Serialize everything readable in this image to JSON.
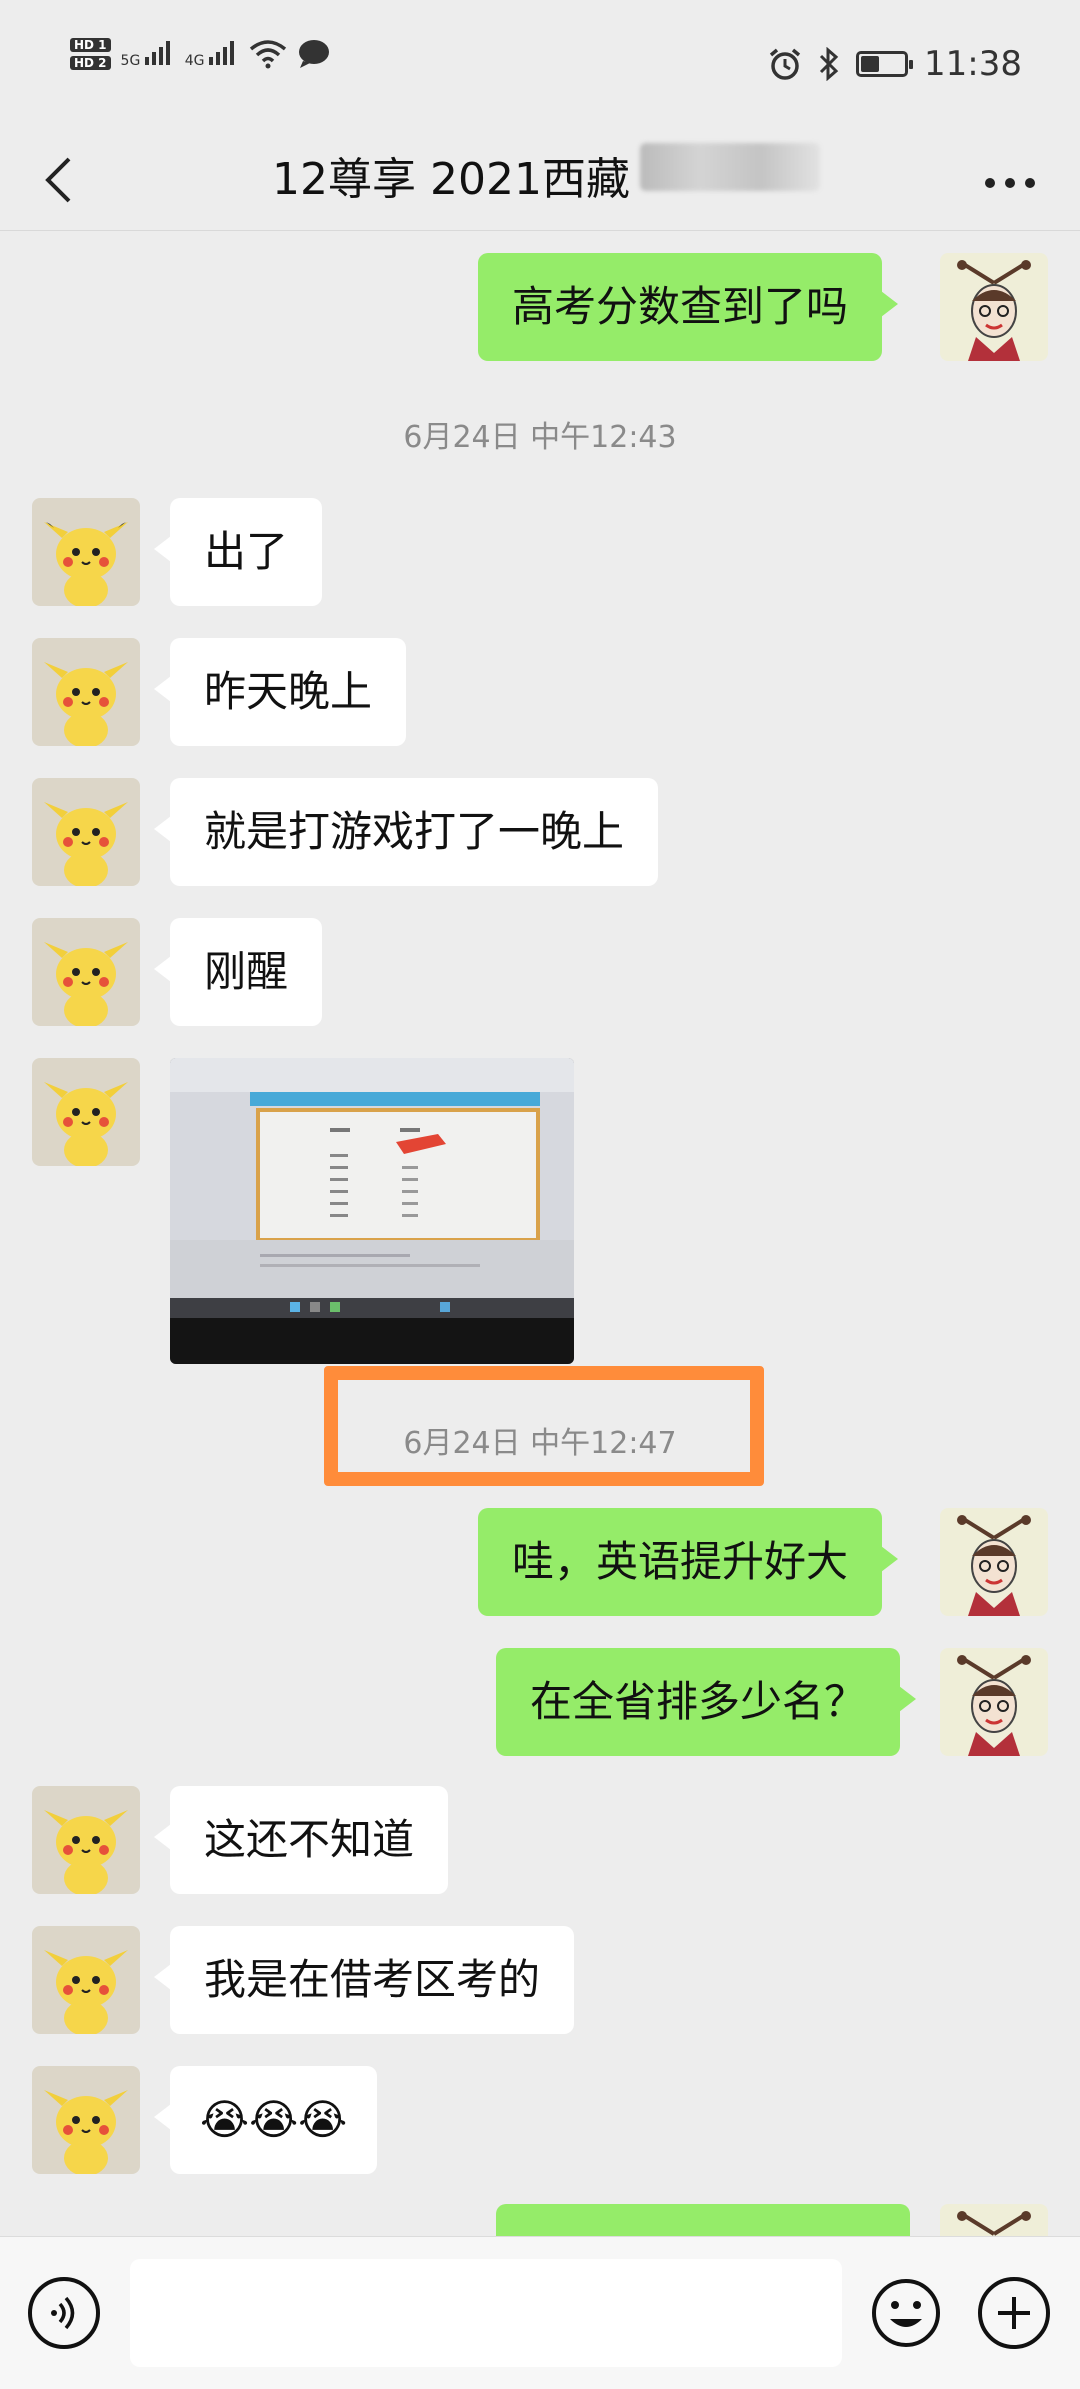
{
  "status_bar": {
    "hd1": "HD 1",
    "hd2": "HD 2",
    "net1": "5G",
    "net2": "4G",
    "time": "11:38"
  },
  "nav": {
    "back_icon": "back-chevron-icon",
    "title": "12尊享 2021西藏",
    "more_icon": "more-dots-icon"
  },
  "messages": [
    {
      "side": "out",
      "text": "高考分数查到了吗"
    },
    {
      "type": "time",
      "text": "6月24日 中午12:43"
    },
    {
      "side": "in",
      "text": "出了"
    },
    {
      "side": "in",
      "text": "昨天晚上"
    },
    {
      "side": "in",
      "text": "就是打游戏打了一晚上"
    },
    {
      "side": "in",
      "text": "刚醒"
    },
    {
      "side": "in",
      "type": "image"
    },
    {
      "type": "time",
      "text": "6月24日 中午12:47"
    },
    {
      "side": "out",
      "text": "哇，英语提升好大"
    },
    {
      "side": "out",
      "text": "在全省排多少名？"
    },
    {
      "side": "in",
      "text": "这还不知道"
    },
    {
      "side": "in",
      "text": "我是在借考区考的"
    },
    {
      "side": "in",
      "text": "😭😭😭"
    }
  ],
  "input_bar": {
    "voice_icon": "voice-icon",
    "emoji_icon": "emoji-icon",
    "plus_icon": "plus-icon",
    "placeholder": ""
  },
  "colors": {
    "out_bubble": "#95ec69",
    "in_bubble": "#ffffff",
    "background": "#ededed",
    "highlight": "#ff8c3a"
  }
}
